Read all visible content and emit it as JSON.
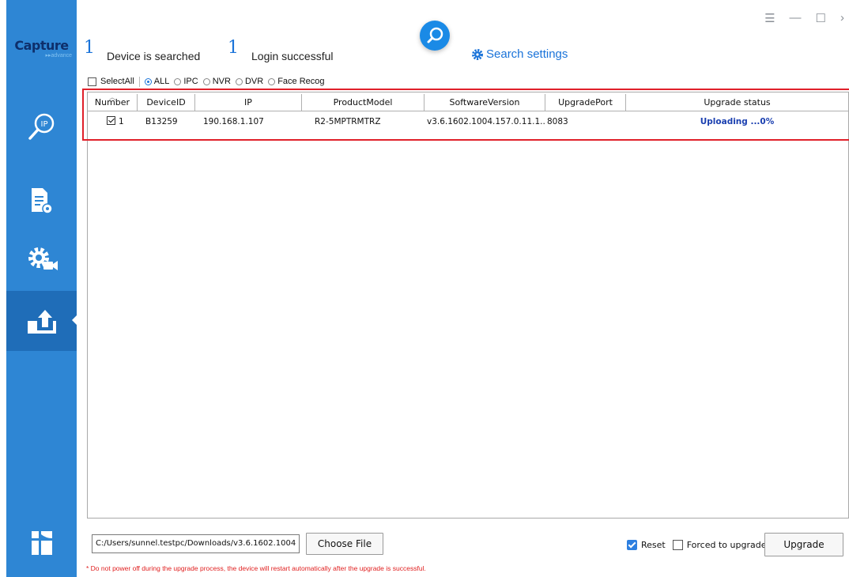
{
  "app": {
    "logo_text": "Capture",
    "logo_subtext": "advance"
  },
  "header": {
    "device_count": "1",
    "device_label": "Device is searched",
    "login_count": "1",
    "login_label": "Login successful",
    "search_settings_label": "Search settings"
  },
  "filters": {
    "select_all_label": "SelectAll",
    "types": [
      {
        "label": "ALL",
        "selected": true
      },
      {
        "label": "IPC",
        "selected": false
      },
      {
        "label": "NVR",
        "selected": false
      },
      {
        "label": "DVR",
        "selected": false
      },
      {
        "label": "Face Recog",
        "selected": false
      }
    ]
  },
  "table": {
    "columns": [
      "Number",
      "DeviceID",
      "IP",
      "ProductModel",
      "SoftwareVersion",
      "UpgradePort",
      "Upgrade status"
    ],
    "rows": [
      {
        "checked": true,
        "number": "1",
        "device_id": "B13259",
        "ip": "190.168.1.107",
        "product_model": "R2-5MPTRMTRZ",
        "software_version": "v3.6.1602.1004.157.0.11.1....",
        "upgrade_port": "8083",
        "upgrade_status": "Uploading ...0%"
      }
    ]
  },
  "bottom": {
    "file_path": "C:/Users/sunnel.testpc/Downloads/v3.6.1602.1004",
    "choose_file_label": "Choose File",
    "reset_label": "Reset",
    "reset_checked": true,
    "forced_label": "Forced to upgrade",
    "forced_checked": false,
    "upgrade_label": "Upgrade",
    "warning": "* Do not power off during the upgrade process, the device will restart automatically after the upgrade is successful."
  },
  "colors": {
    "sidebar": "#2e86d4",
    "sidebar_active": "#1f6db8",
    "accent": "#1a73d9",
    "highlight_border": "#e0202a",
    "warning": "#e02020"
  },
  "icons": {
    "titlebar": [
      "menu-icon",
      "minimize-icon",
      "maximize-icon",
      "close-icon"
    ],
    "nav": [
      "ip-search-icon",
      "document-settings-icon",
      "gear-camera-icon",
      "upload-icon"
    ]
  }
}
